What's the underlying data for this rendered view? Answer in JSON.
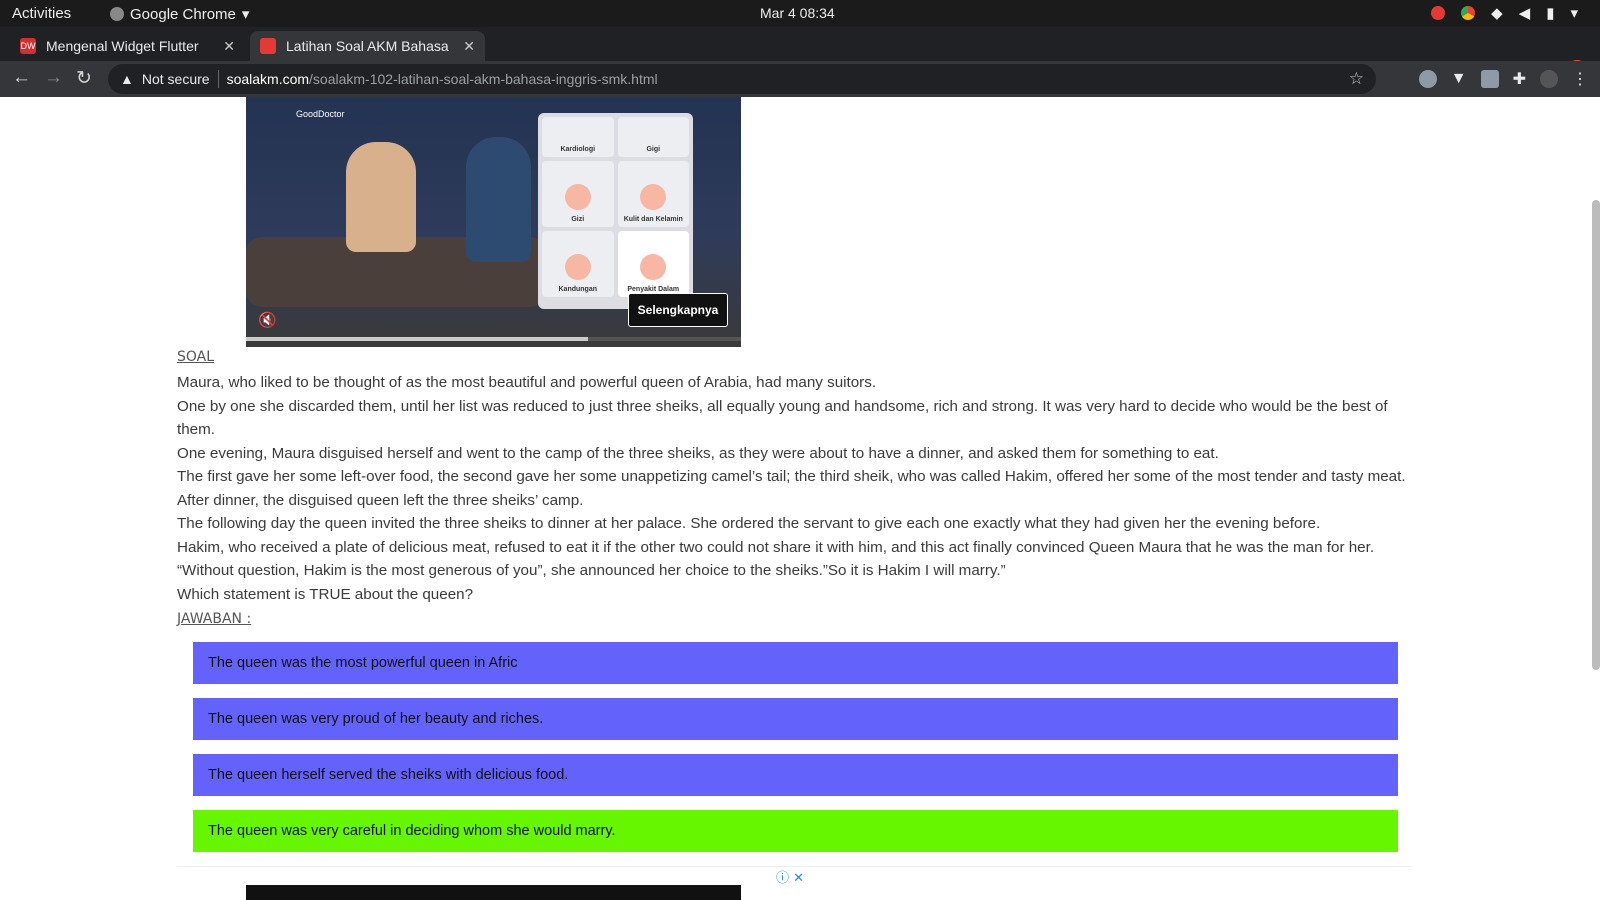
{
  "os": {
    "activities": "Activities",
    "app_name": "Google Chrome",
    "clock": "Mar 4  08:34"
  },
  "tabs": [
    {
      "title": "Mengenal Widget Flutter",
      "favicon_text": "DW",
      "active": false
    },
    {
      "title": "Latihan Soal AKM Bahasa",
      "favicon_text": "",
      "active": true
    }
  ],
  "omnibox": {
    "security_label": "Not secure",
    "host": "soalakm.com",
    "path": "/soalakm-102-latihan-soal-akm-bahasa-inggris-smk.html"
  },
  "video_ad": {
    "brand": "GoodDoctor",
    "cells": [
      "Kardiologi",
      "Gigi",
      "Gizi",
      "Kulit dan Kelamin",
      "Kandungan",
      "Penyakit Dalam"
    ],
    "cta": "Selengkapnya",
    "progress": 0.69
  },
  "question": {
    "heading": "SOAL",
    "paragraphs": [
      "Maura, who liked to be thought of as the most beautiful and powerful queen of Arabia, had many suitors.",
      "One by one she discarded them, until her list was reduced to just three sheiks, all equally young and handsome, rich and strong. It was very hard to decide who would be the best of them.",
      "One evening, Maura disguised herself and went to the camp of the three sheiks, as they were about to have a dinner, and asked them for something to eat.",
      "The first gave her some left-over food, the second gave her some unappetizing camel’s tail; the third sheik, who was called Hakim, offered her some of the most tender and tasty meat. After dinner, the disguised queen left the three sheiks’ camp.",
      "The following day the queen invited the three sheiks to dinner at her palace. She ordered the servant to give each one exactly what they had given her the evening before.",
      "Hakim, who received a plate of delicious meat, refused to eat it if the other two could not share it with him, and this act finally convinced Queen Maura that he was the man for her. “Without question, Hakim is the most generous of you”, she announced her choice to the sheiks.”So it is Hakim I will marry.”",
      "Which statement is TRUE about the queen?"
    ]
  },
  "answers": {
    "heading": "JAWABAN :",
    "options": [
      {
        "text": "The queen was the most powerful queen in Afric",
        "correct": false
      },
      {
        "text": "The queen was very proud of her beauty and riches.",
        "correct": false
      },
      {
        "text": "The queen herself served the sheiks with delicious food.",
        "correct": false
      },
      {
        "text": "The queen was very careful in deciding whom she would marry.",
        "correct": true
      }
    ],
    "colors": {
      "default": "#6363fb",
      "correct": "#66f700"
    }
  }
}
